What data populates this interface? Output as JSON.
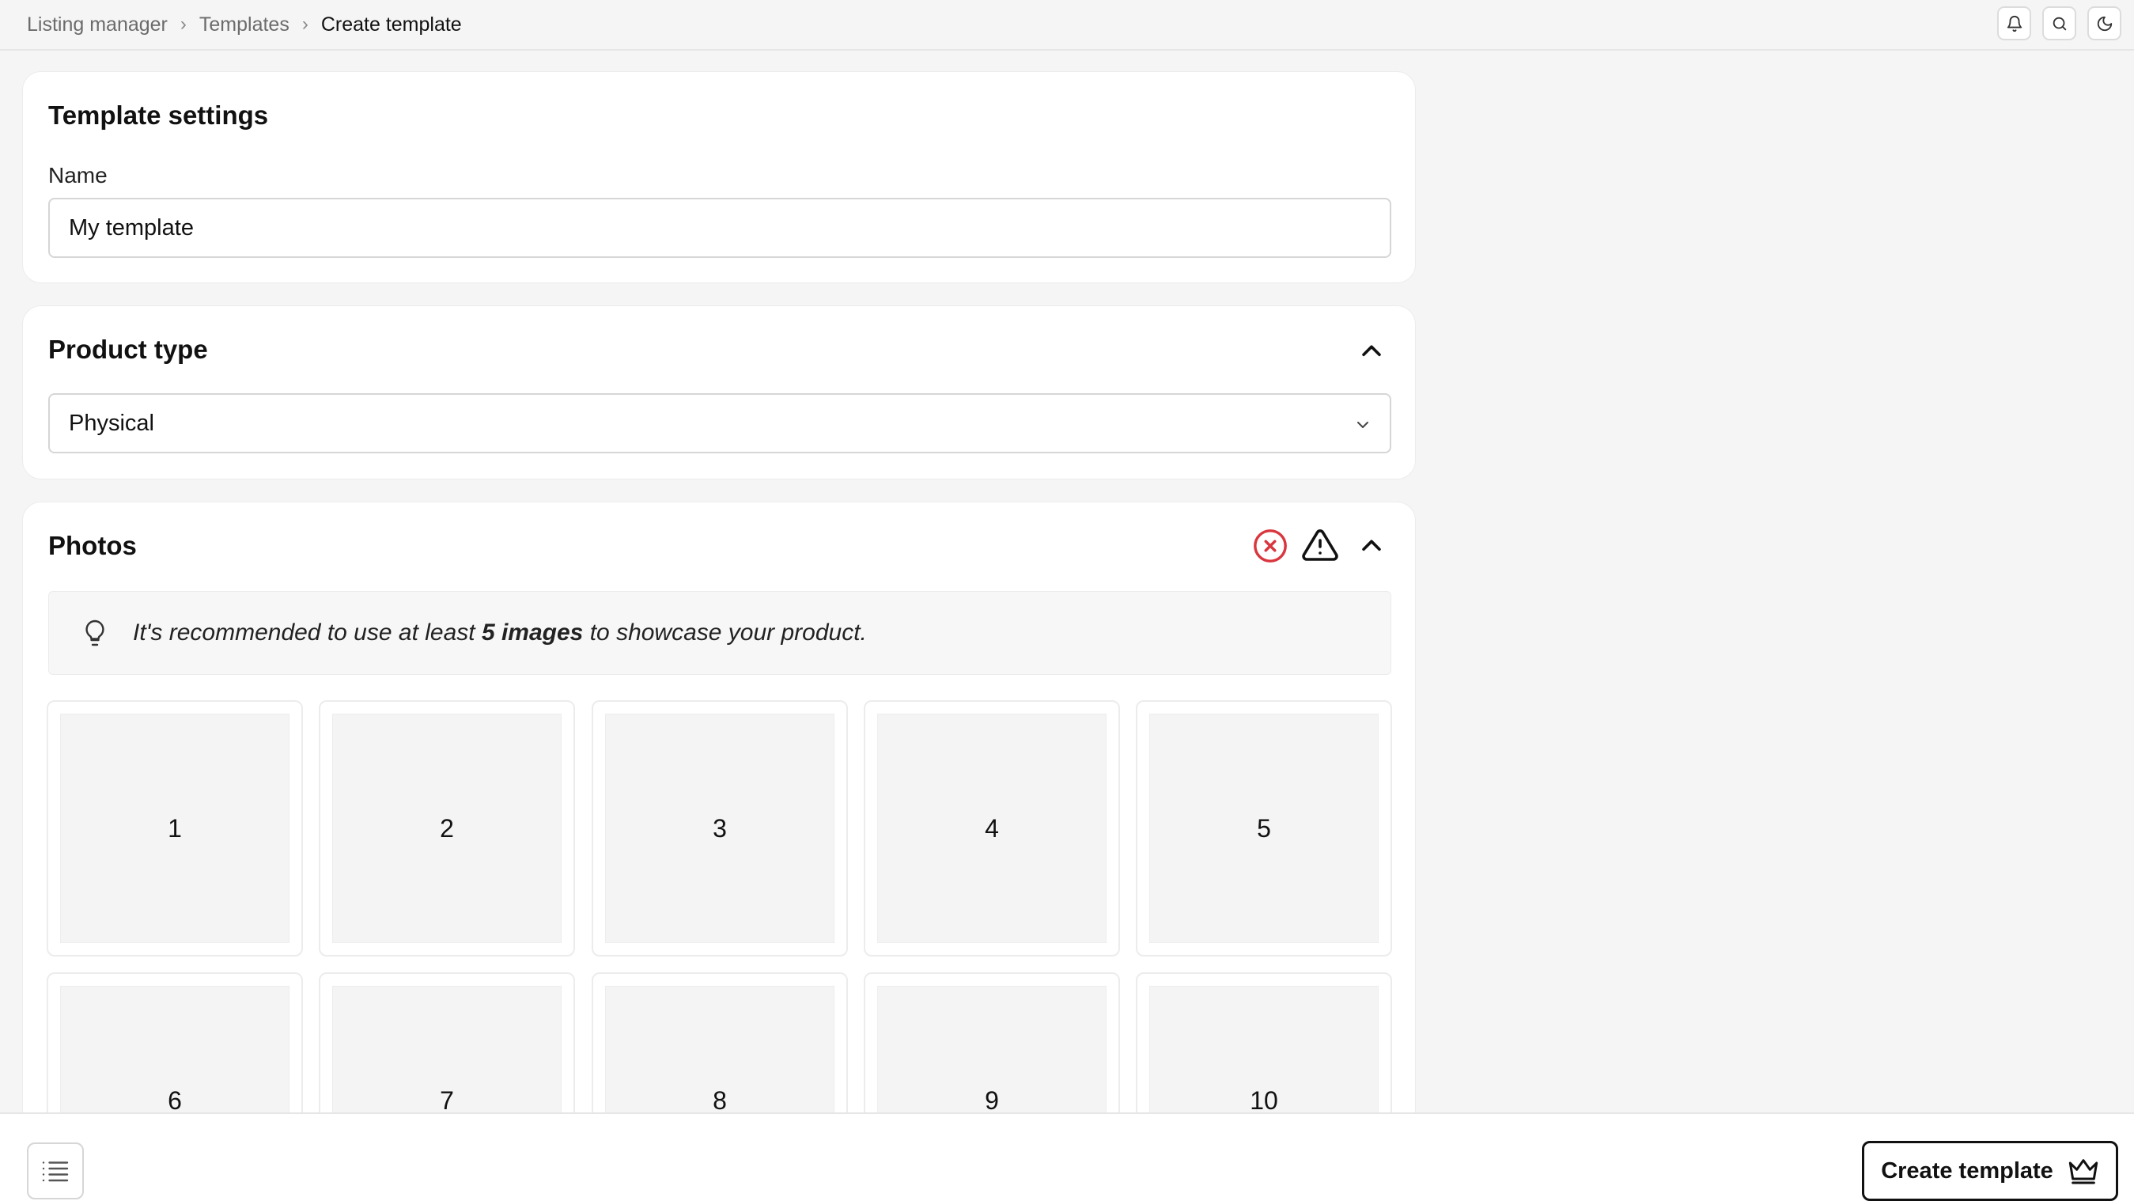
{
  "breadcrumb": {
    "items": [
      "Listing manager",
      "Templates",
      "Create template"
    ]
  },
  "topbar": {
    "icons": [
      "bell-icon",
      "search-icon",
      "moon-icon"
    ]
  },
  "template_settings": {
    "title": "Template settings",
    "name_label": "Name",
    "name_value": "My template"
  },
  "product_type": {
    "title": "Product type",
    "selected": "Physical"
  },
  "photos": {
    "title": "Photos",
    "status_icons": [
      "error-circle-icon",
      "warning-triangle-icon"
    ],
    "tip_prefix": "It's recommended to use at least ",
    "tip_bold": "5 images",
    "tip_suffix": " to showcase your product.",
    "slots": [
      "1",
      "2",
      "3",
      "4",
      "5",
      "6",
      "7",
      "8",
      "9",
      "10"
    ]
  },
  "footer": {
    "create_label": "Create template"
  },
  "colors": {
    "error": "#d9363e",
    "text": "#111111",
    "muted": "#6b6b6b"
  }
}
